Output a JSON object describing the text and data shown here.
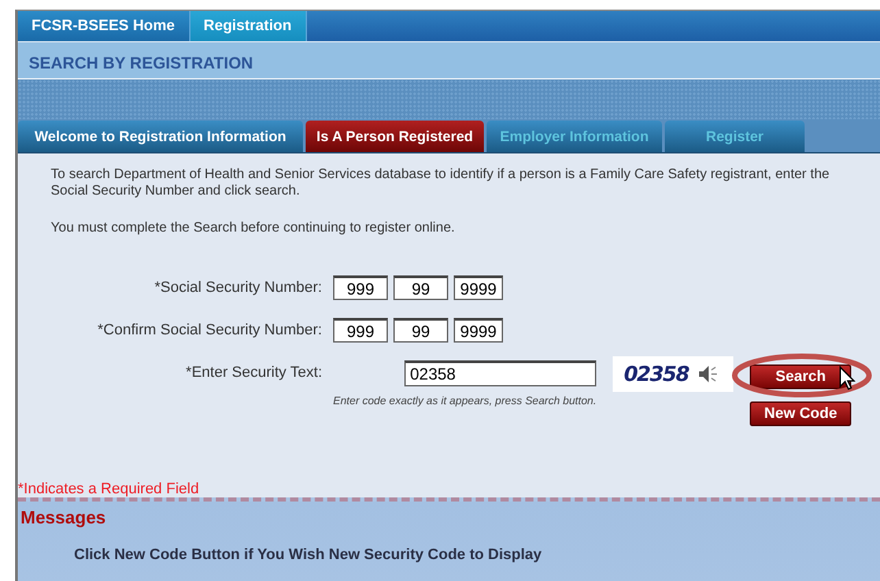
{
  "nav": [
    {
      "label": "FCSR-BSEES Home",
      "selected": false
    },
    {
      "label": "Registration",
      "selected": true
    }
  ],
  "page_title": "SEARCH BY REGISTRATION",
  "tabs": [
    {
      "label": "Welcome to Registration Information",
      "selected": false,
      "disabled": false
    },
    {
      "label": "Is A Person Registered",
      "selected": true,
      "disabled": false
    },
    {
      "label": "Employer Information",
      "selected": false,
      "disabled": true
    },
    {
      "label": "Register",
      "selected": false,
      "disabled": true
    }
  ],
  "intro": [
    "To search Department of Health and Senior Services database to identify if a person is a Family Care Safety registrant, enter the Social Security Number and click search.",
    "You must complete the Search before continuing to register online."
  ],
  "ssn": {
    "label": "*Social Security Number:",
    "parts": [
      "999",
      "99",
      "9999"
    ]
  },
  "confirm_ssn": {
    "label": "*Confirm Social Security Number:",
    "parts": [
      "999",
      "99",
      "9999"
    ]
  },
  "security": {
    "label": "*Enter Security Text:",
    "value": "02358",
    "captcha": "02358",
    "hint": "Enter code exactly as it appears, press Search button."
  },
  "buttons": [
    {
      "label": "Search",
      "highlighted": true
    },
    {
      "label": "New Code",
      "highlighted": false
    }
  ],
  "required_note": "*Indicates a Required Field",
  "messages": {
    "title": "Messages",
    "items": [
      "Click New Code Button if You Wish New Security Code to Display"
    ]
  }
}
